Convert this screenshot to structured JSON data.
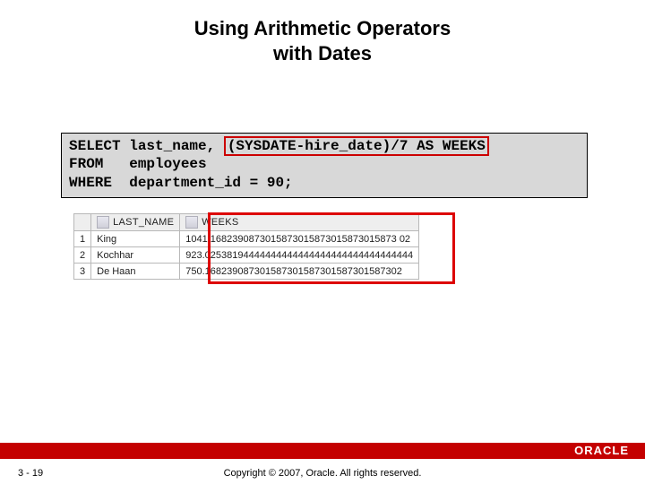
{
  "title_line1": "Using Arithmetic Operators",
  "title_line2": "with Dates",
  "sql": {
    "kw_select": "SELECT",
    "after_select": " last_name, ",
    "highlight": "(SYSDATE-hire_date)/7 AS WEEKS",
    "line2": "FROM   employees",
    "line3": "WHERE  department_id = 90;"
  },
  "columns": {
    "c1": "LAST_NAME",
    "c2": "WEEKS"
  },
  "rows": [
    {
      "n": "1",
      "last_name": "King",
      "weeks": "1041.1682390873015873015873015873015873 02"
    },
    {
      "n": "2",
      "last_name": "Kochhar",
      "weeks": "923.02538194444444444444444444444444444444"
    },
    {
      "n": "3",
      "last_name": "De Haan",
      "weeks": "750.168239087301587301587301587301587302"
    }
  ],
  "page_number": "3 - 19",
  "copyright": "Copyright © 2007, Oracle. All rights reserved.",
  "logo": "ORACLE"
}
